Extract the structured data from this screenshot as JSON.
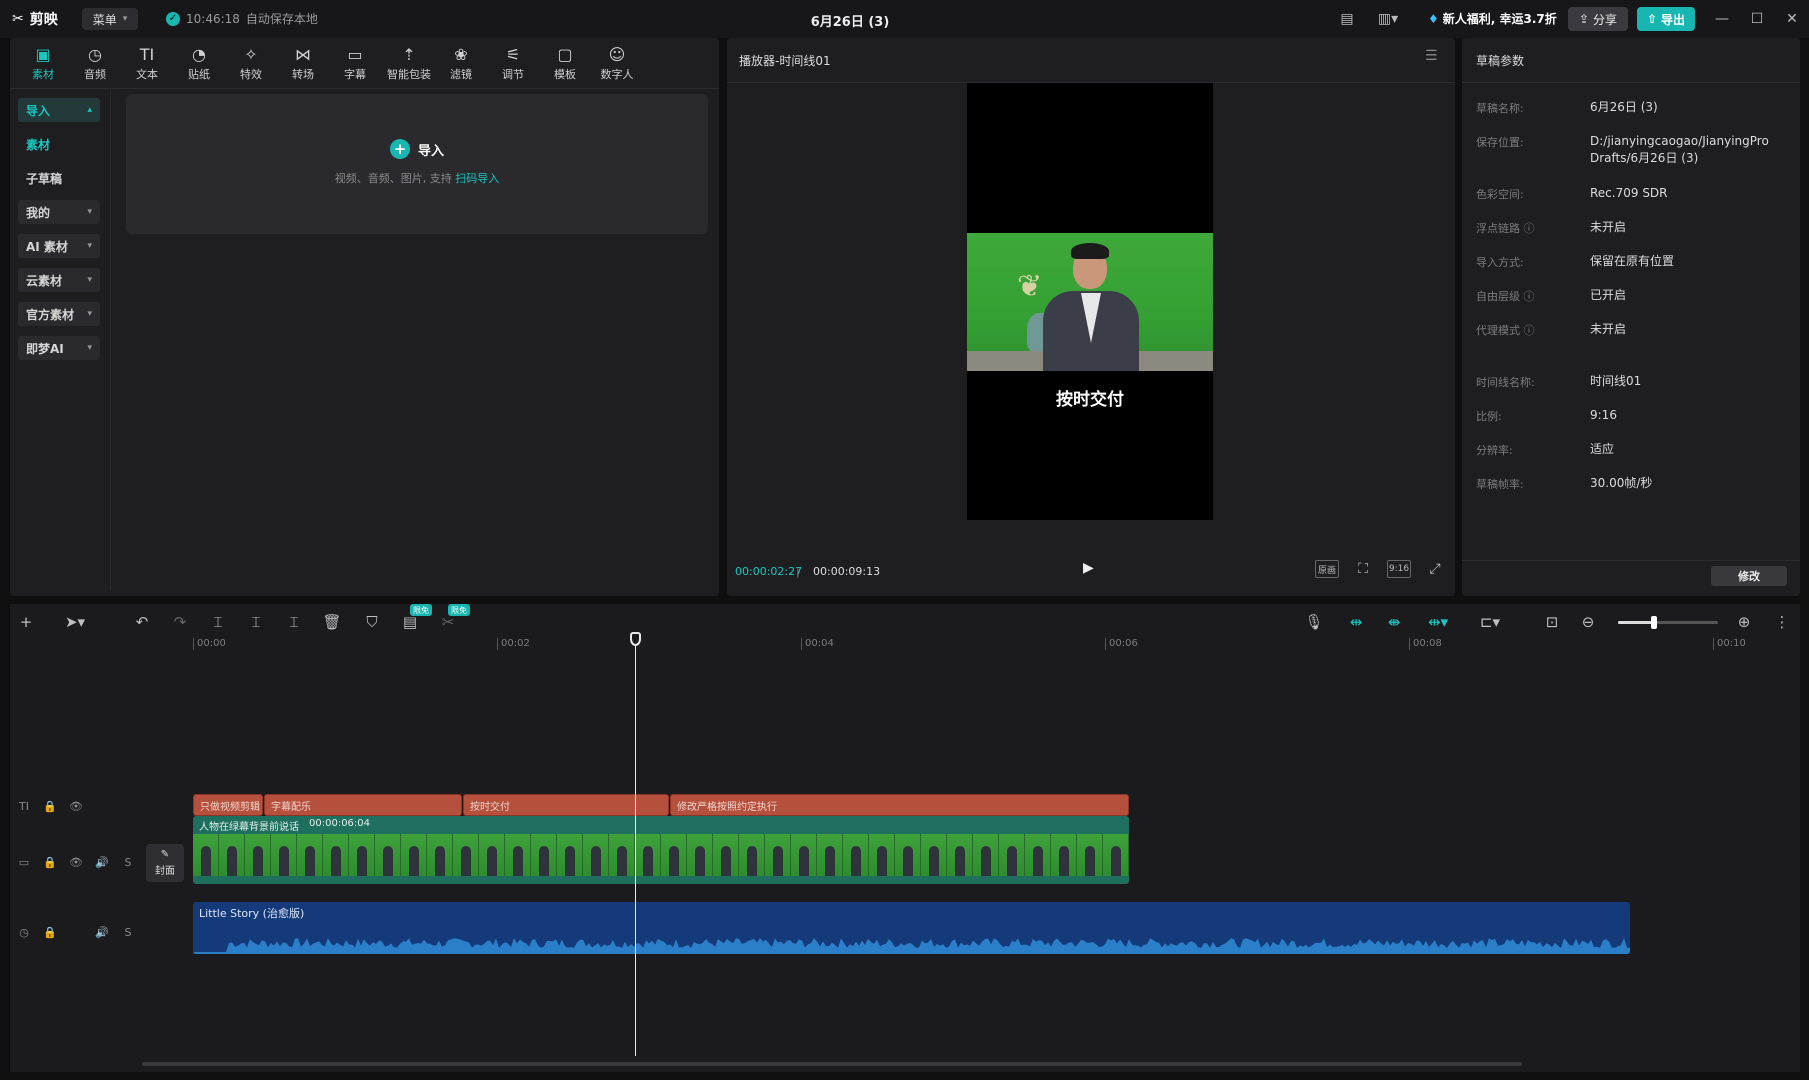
{
  "app": {
    "name": "剪映",
    "menu_label": "菜单",
    "autosave_time": "10:46:18",
    "autosave_text": "自动保存本地",
    "project_title": "6月26日 (3)",
    "promo_text": "新人福利, 幸运3.7折",
    "share_label": "分享",
    "export_label": "导出"
  },
  "tool_tabs": [
    {
      "label": "素材",
      "icon": "media-icon"
    },
    {
      "label": "音频",
      "icon": "audio-icon"
    },
    {
      "label": "文本",
      "icon": "text-icon"
    },
    {
      "label": "贴纸",
      "icon": "sticker-icon"
    },
    {
      "label": "特效",
      "icon": "effects-icon"
    },
    {
      "label": "转场",
      "icon": "transition-icon"
    },
    {
      "label": "字幕",
      "icon": "caption-icon"
    },
    {
      "label": "智能包装",
      "icon": "smart-pack-icon"
    },
    {
      "label": "滤镜",
      "icon": "filter-icon"
    },
    {
      "label": "调节",
      "icon": "adjust-icon"
    },
    {
      "label": "模板",
      "icon": "template-icon"
    },
    {
      "label": "数字人",
      "icon": "digital-human-icon"
    }
  ],
  "left_nav": [
    {
      "label": "导入"
    },
    {
      "label": "素材"
    },
    {
      "label": "子草稿"
    },
    {
      "label": "我的"
    },
    {
      "label": "AI 素材"
    },
    {
      "label": "云素材"
    },
    {
      "label": "官方素材"
    },
    {
      "label": "即梦AI"
    }
  ],
  "import_box": {
    "button_label": "导入",
    "hint": "视频、音频、图片, 支持",
    "hint_link": "扫码导入"
  },
  "player": {
    "title": "播放器-时间线01",
    "subtitle_text": "按时交付",
    "current_time": "00:00:02:27",
    "total_time": "00:00:09:13",
    "tool_original": "原画",
    "tool_ratio": "9:16"
  },
  "draft": {
    "title": "草稿参数",
    "params": [
      {
        "label": "草稿名称:",
        "value": "6月26日 (3)"
      },
      {
        "label": "保存位置:",
        "value": "D:/jianyingcaogao/JianyingPro Drafts/6月26日 (3)"
      },
      {
        "label": "色彩空间:",
        "value": "Rec.709 SDR"
      },
      {
        "label": "浮点链路",
        "value": "未开启"
      },
      {
        "label": "导入方式:",
        "value": "保留在原有位置"
      },
      {
        "label": "自由层级",
        "value": "已开启"
      },
      {
        "label": "代理模式",
        "value": "未开启"
      },
      {
        "label": "时间线名称:",
        "value": "时间线01"
      },
      {
        "label": "比例:",
        "value": "9:16"
      },
      {
        "label": "分辨率:",
        "value": "适应"
      },
      {
        "label": "草稿帧率:",
        "value": "30.00帧/秒"
      }
    ],
    "modify_label": "修改"
  },
  "timeline": {
    "free_badge": "限免",
    "ruler": [
      "00:00",
      "00:02",
      "00:04",
      "00:06",
      "00:08",
      "00:10"
    ],
    "text_clips": [
      "只做视频剪辑",
      "字幕配乐",
      "按时交付",
      "修改严格按照约定执行"
    ],
    "video_clip": {
      "name": "人物在绿幕背景前说话",
      "duration": "00:00:06:04"
    },
    "audio_clip": {
      "name": "Little Story (治愈版)"
    },
    "cover_label": "封面"
  },
  "colors": {
    "accent": "#18b6b0",
    "text_clip": "#b5503c",
    "video_clip": "#1f6f5e",
    "audio_clip": "#153a7a"
  }
}
